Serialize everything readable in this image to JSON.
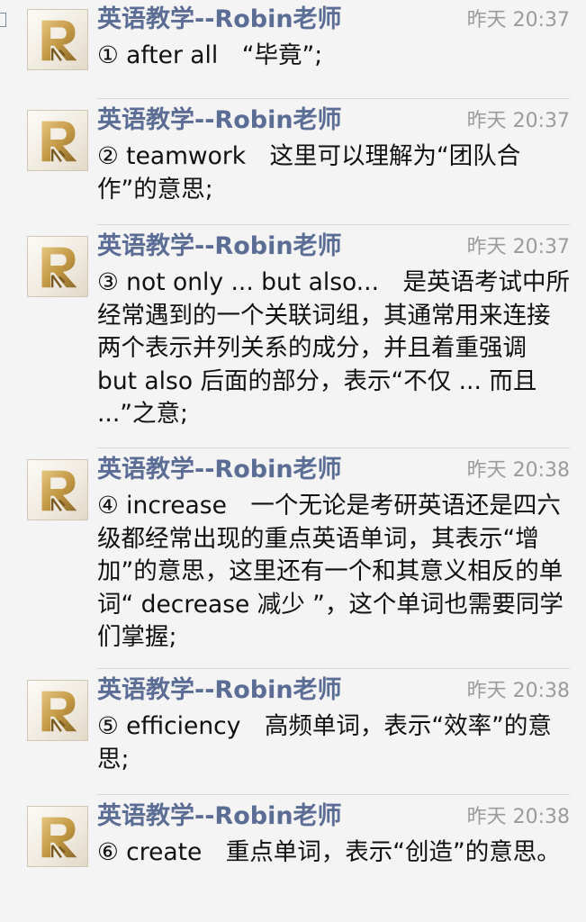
{
  "messages": [
    {
      "sender": "英语教学--Robin老师",
      "time": "昨天 20:37",
      "text": "① after all　“毕竟”;"
    },
    {
      "sender": "英语教学--Robin老师",
      "time": "昨天 20:37",
      "text": "② teamwork　这里可以理解为“团队合作”的意思;"
    },
    {
      "sender": "英语教学--Robin老师",
      "time": "昨天 20:37",
      "text": "③ not only ... but also...　是英语考试中所经常遇到的一个关联词组，其通常用来连接两个表示并列关系的成分，并且着重强调 but also 后面的部分，表示“不仅 ... 而且 ...”之意;"
    },
    {
      "sender": "英语教学--Robin老师",
      "time": "昨天 20:38",
      "text": "④ increase　一个无论是考研英语还是四六级都经常出现的重点英语单词，其表示“增加”的意思，这里还有一个和其意义相反的单词“ decrease 减少 ”，这个单词也需要同学们掌握;"
    },
    {
      "sender": "英语教学--Robin老师",
      "time": "昨天 20:38",
      "text": "⑤ efficiency　高频单词，表示“效率”的意思;"
    },
    {
      "sender": "英语教学--Robin老师",
      "time": "昨天 20:38",
      "text": "⑥ create　重点单词，表示“创造”的意思。"
    }
  ]
}
